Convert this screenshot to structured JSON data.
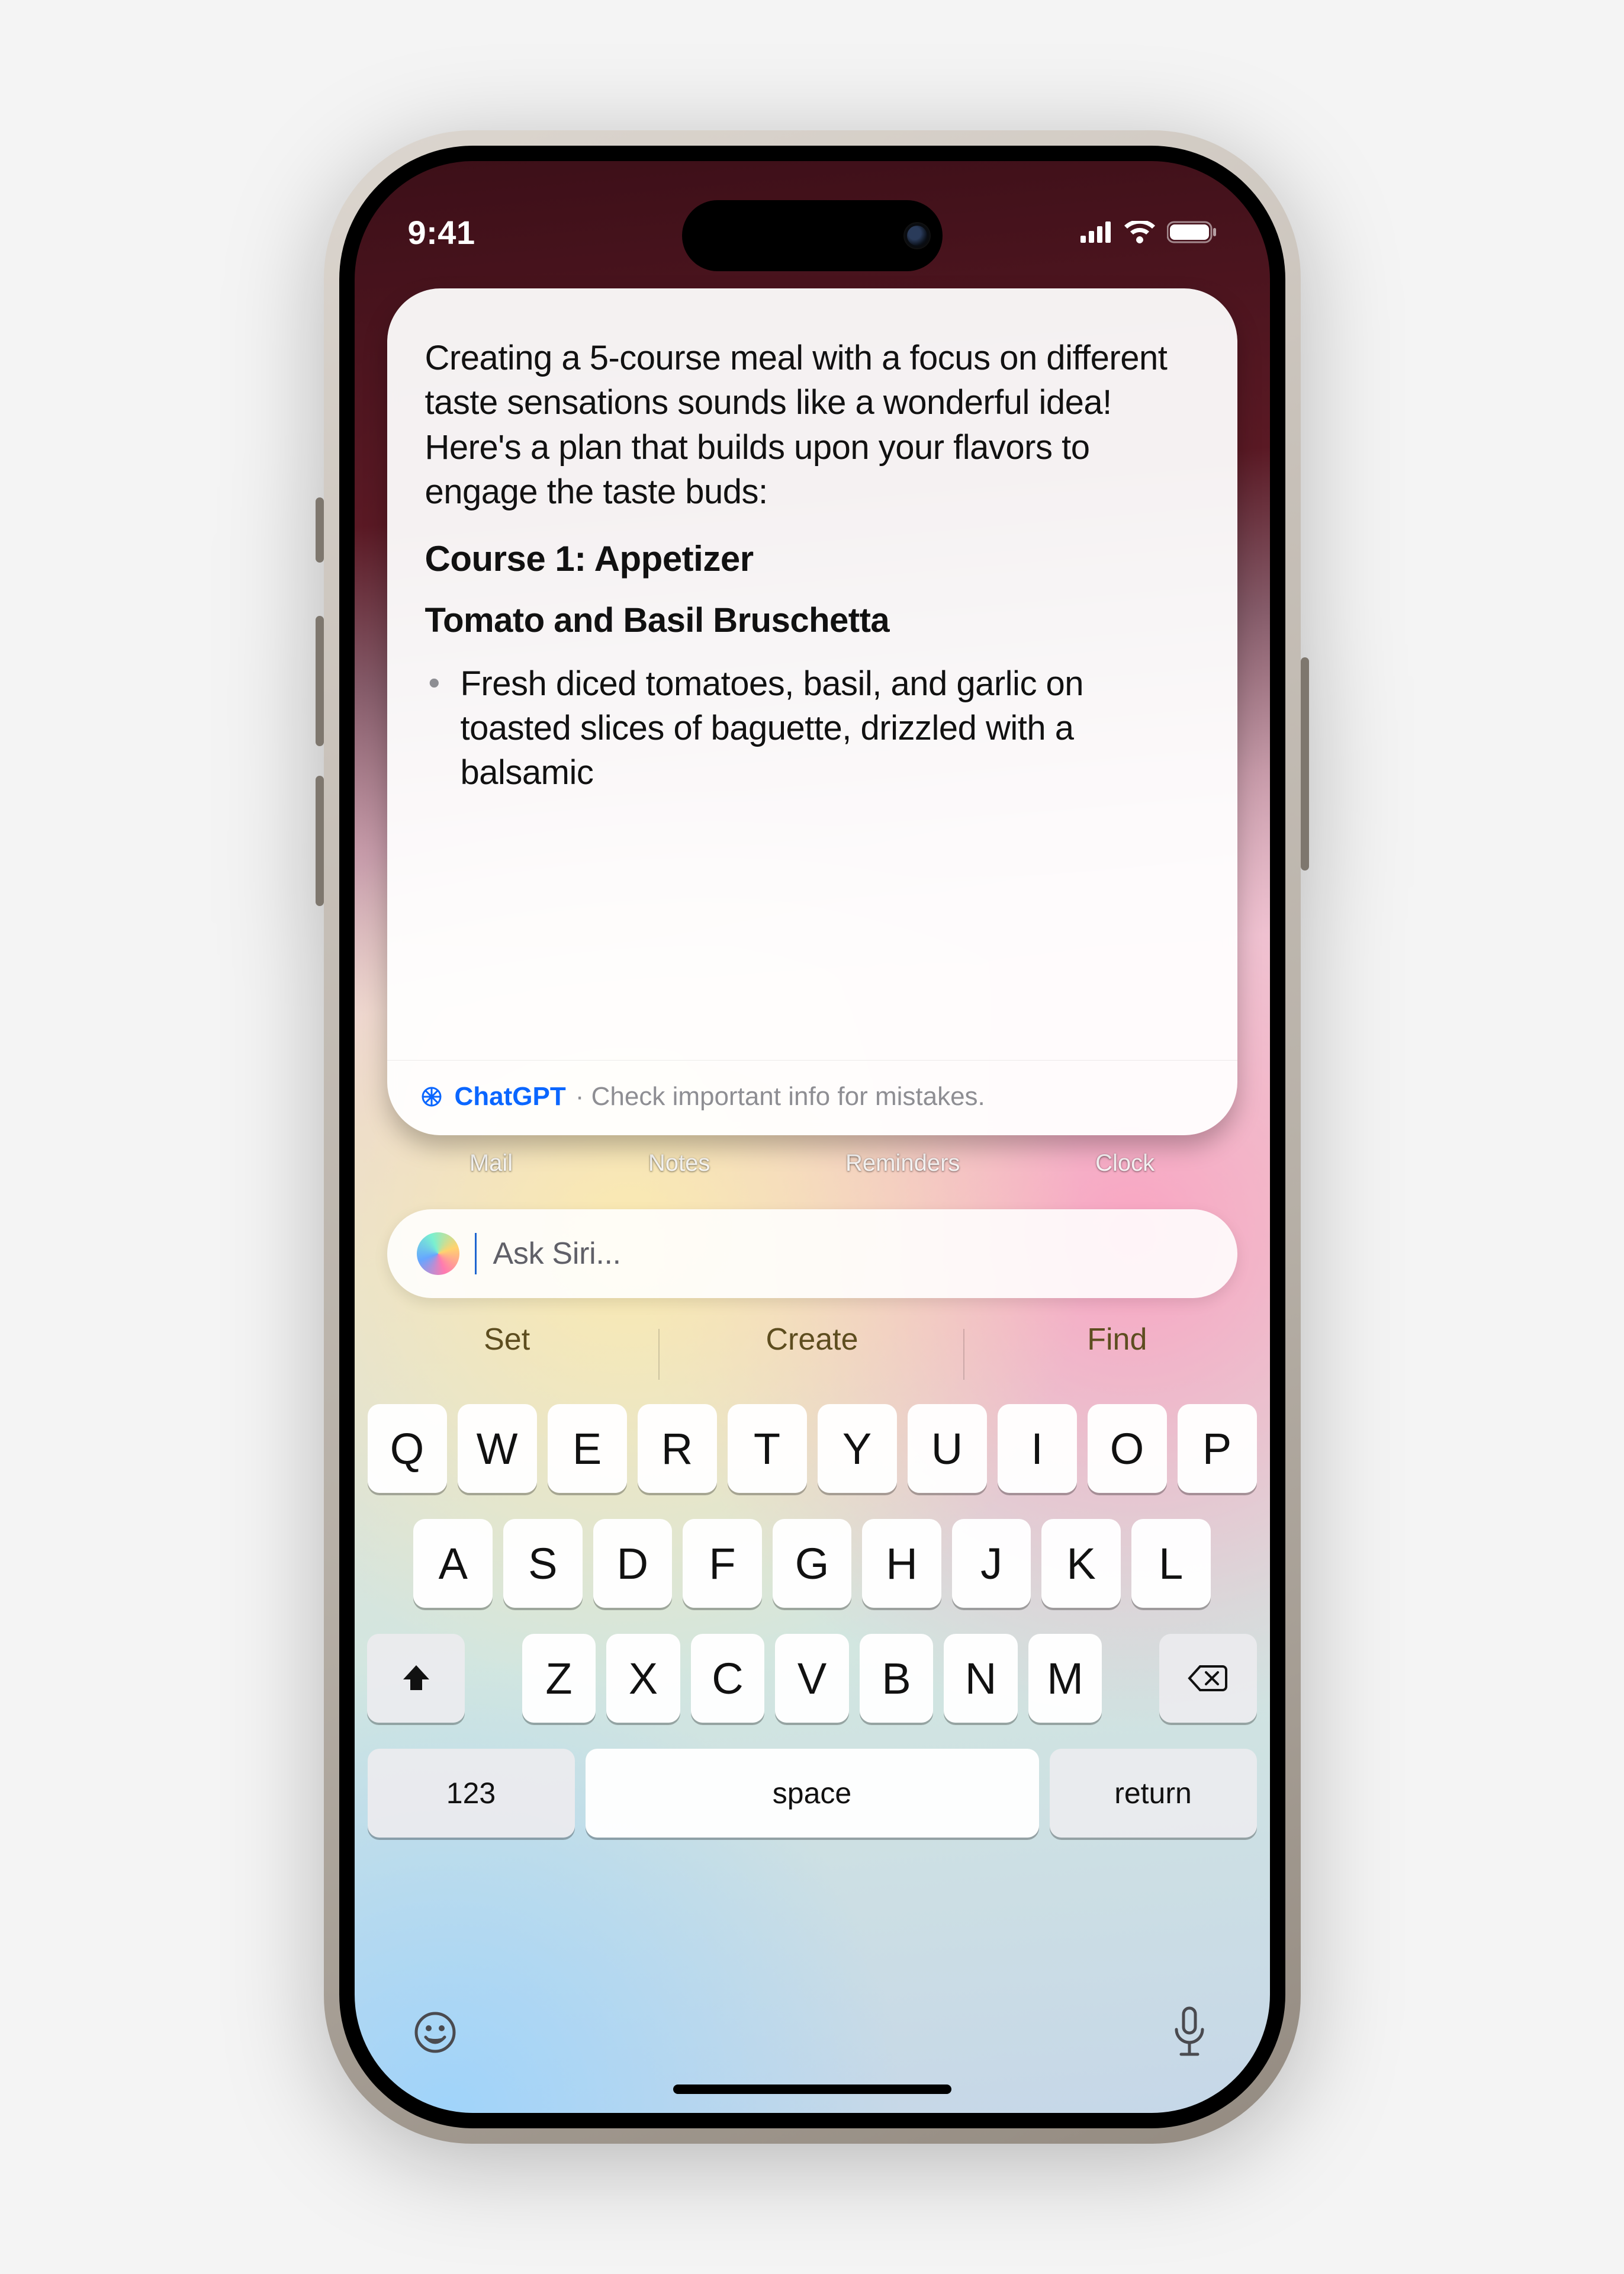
{
  "status": {
    "time": "9:41"
  },
  "card": {
    "intro": "Creating a 5-course meal with a focus on different taste sensations sounds like a wonderful idea! Here's a plan that builds upon your flavors to engage the taste buds:",
    "course_heading": "Course 1: Appetizer",
    "dish_heading": "Tomato and Basil Bruschetta",
    "bullet1": "Fresh diced tomatoes, basil, and garlic on toasted slices of baguette, drizzled with a balsamic",
    "provider": "ChatGPT",
    "disclaimer": "Check important info for mistakes."
  },
  "dock": {
    "items": [
      "Mail",
      "Notes",
      "Reminders",
      "Clock"
    ]
  },
  "ask": {
    "placeholder": "Ask Siri..."
  },
  "suggestions": [
    "Set",
    "Create",
    "Find"
  ],
  "keyboard": {
    "row1": [
      "Q",
      "W",
      "E",
      "R",
      "T",
      "Y",
      "U",
      "I",
      "O",
      "P"
    ],
    "row2": [
      "A",
      "S",
      "D",
      "F",
      "G",
      "H",
      "J",
      "K",
      "L"
    ],
    "row3": [
      "Z",
      "X",
      "C",
      "V",
      "B",
      "N",
      "M"
    ],
    "numbers": "123",
    "space": "space",
    "return": "return"
  }
}
